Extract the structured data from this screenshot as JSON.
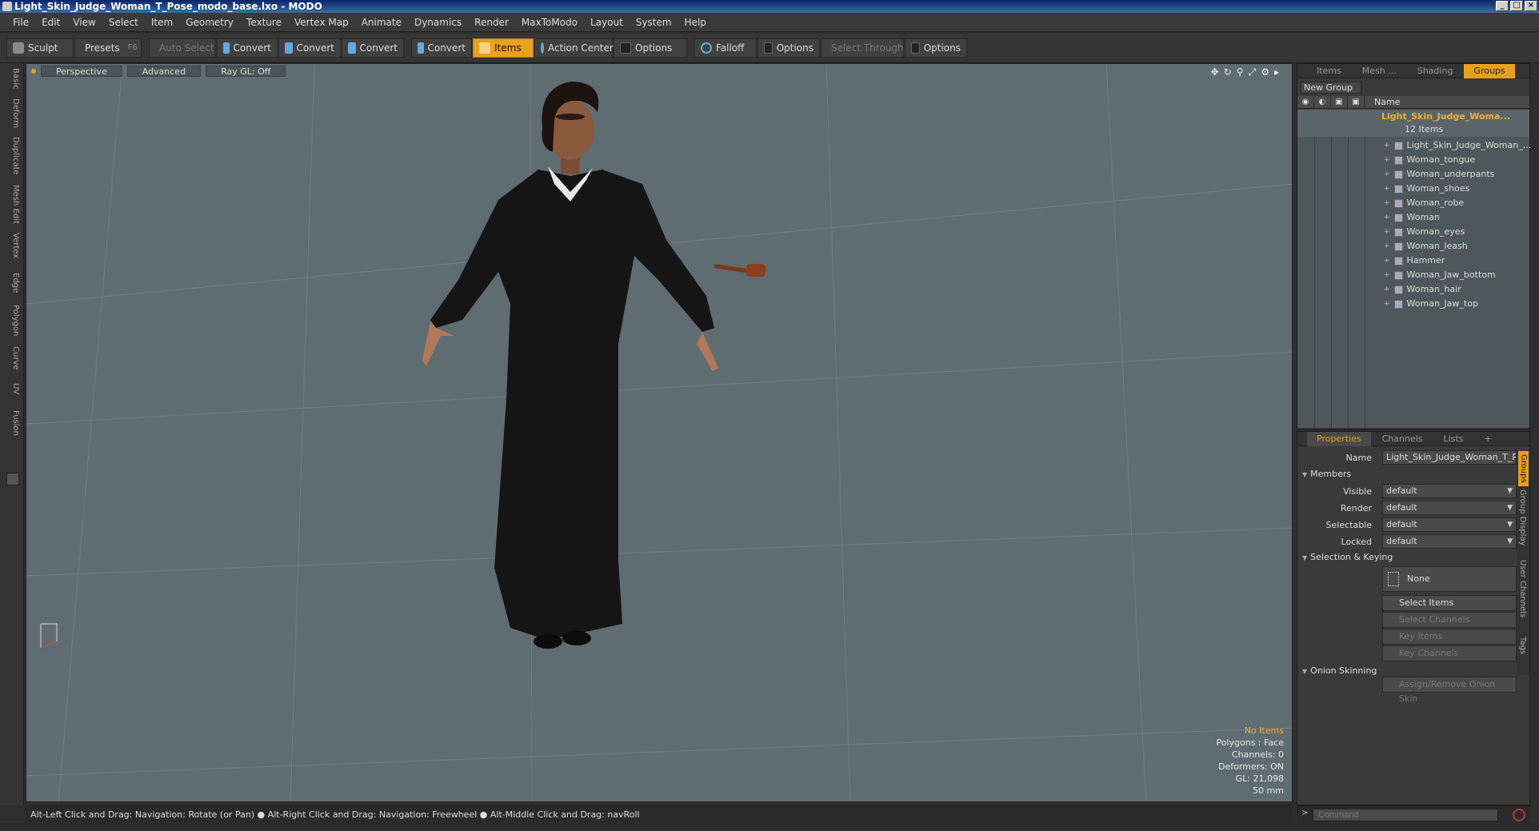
{
  "window": {
    "title": "Light_Skin_Judge_Woman_T_Pose_modo_base.lxo - MODO",
    "controls": [
      "_",
      "□",
      "×"
    ]
  },
  "menu": [
    "File",
    "Edit",
    "View",
    "Select",
    "Item",
    "Geometry",
    "Texture",
    "Vertex Map",
    "Animate",
    "Dynamics",
    "Render",
    "MaxToModo",
    "Layout",
    "System",
    "Help"
  ],
  "toolbar": {
    "sculpt": "Sculpt",
    "presets": "Presets",
    "presets_hint": "F6",
    "auto_select": "Auto Select",
    "convert_1": "Convert",
    "convert_2": "Convert",
    "convert_3": "Convert",
    "convert_4": "Convert",
    "items": "Items",
    "action_center": "Action Center",
    "options_1": "Options",
    "falloff": "Falloff",
    "options_2": "Options",
    "select_through": "Select Through",
    "options_3": "Options"
  },
  "left_tabs": [
    "Basic",
    "Deform",
    "Duplicate",
    "Mesh Edit",
    "Vertex",
    "Edge",
    "Polygon",
    "Curve",
    "UV",
    "Fusion"
  ],
  "viewport": {
    "tabs": [
      "Perspective",
      "Advanced",
      "Ray GL: Off"
    ],
    "icons": [
      "move-icon",
      "rotate-icon",
      "zoom-icon",
      "maximize-icon",
      "settings-icon",
      "expand-icon"
    ],
    "info": {
      "no_items": "No Items",
      "polygons": "Polygons : Face",
      "channels": "Channels: 0",
      "deformers": "Deformers: ON",
      "gl": "GL: 21,098",
      "scale": "50 mm"
    }
  },
  "status_bar": "Alt-Left Click and Drag: Navigation: Rotate (or Pan) ● Alt-Right Click and Drag: Navigation: Freewheel ● Alt-Middle Click and Drag: navRoll",
  "groups_panel": {
    "tabs": [
      "Items",
      "Mesh ...",
      "Shading",
      "Groups"
    ],
    "active_tab": "Groups",
    "new_group": "New Group",
    "header_name": "Name",
    "root_name": "Light_Skin_Judge_Woma...",
    "root_count": "12 Items",
    "children": [
      "Light_Skin_Judge_Woman_...",
      "Woman_tongue",
      "Woman_underpants",
      "Woman_shoes",
      "Woman_robe",
      "Woman",
      "Woman_eyes",
      "Woman_leash",
      "Hammer",
      "Woman_Jaw_bottom",
      "Woman_hair",
      "Woman_Jaw_top"
    ]
  },
  "properties_panel": {
    "tabs": [
      "Properties",
      "Channels",
      "Lists",
      "+"
    ],
    "name_label": "Name",
    "name_value": "Light_Skin_Judge_Woman_T_Pos",
    "members_label": "Members",
    "visible_label": "Visible",
    "visible_value": "default",
    "render_label": "Render",
    "render_value": "default",
    "selectable_label": "Selectable",
    "selectable_value": "default",
    "locked_label": "Locked",
    "locked_value": "default",
    "selection_keying_label": "Selection & Keying",
    "none_btn": "None",
    "select_items": "Select Items",
    "select_channels": "Select Channels",
    "key_items": "Key Items",
    "key_channels": "Key Channels",
    "onion_label": "Onion Skinning",
    "onion_btn": "Assign/Remove Onion Skin",
    "side_tabs": [
      "Groups",
      "Group Display",
      "User Channels",
      "Tags"
    ]
  },
  "command": {
    "placeholder": "Command"
  },
  "colors": {
    "accent": "#e8a020",
    "viewport_bg": "#5f6c72",
    "robe": "#151515"
  }
}
